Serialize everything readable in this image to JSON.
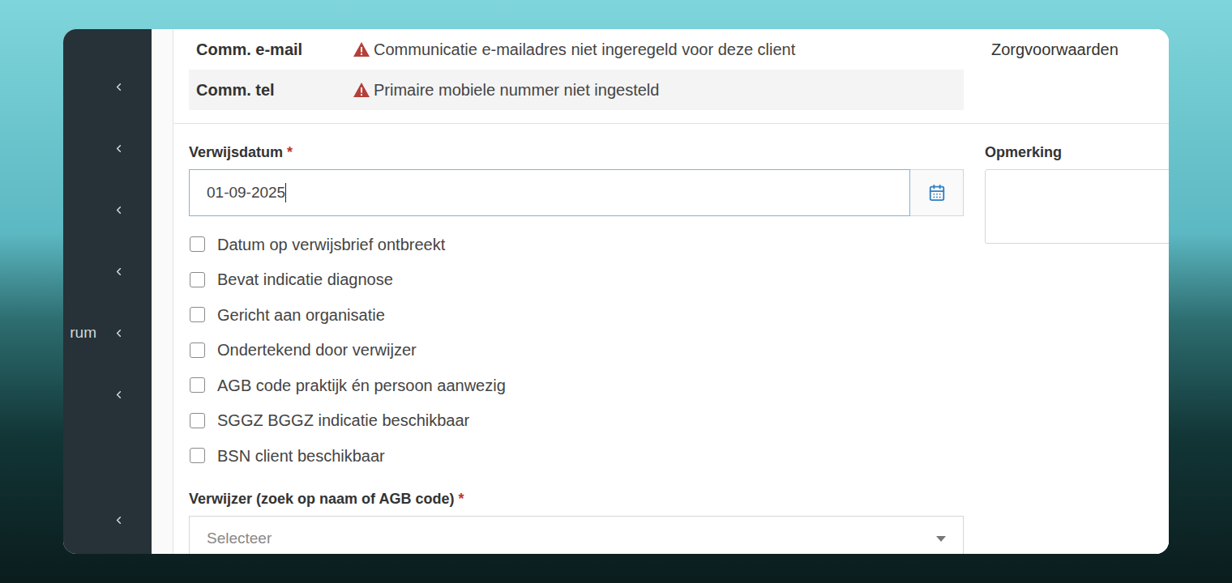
{
  "sidebar": {
    "items": [
      {
        "expanded": false
      },
      {
        "expanded": false
      },
      {
        "expanded": false
      },
      {
        "expanded": false
      },
      {
        "label": "rum",
        "expanded": false
      },
      {
        "expanded": false
      },
      {
        "expanded": false
      }
    ]
  },
  "contact": {
    "rows": [
      {
        "label": "Comm. e-mail",
        "warning": "Communicatie e-mailadres niet ingeregeld voor deze client",
        "shaded": false
      },
      {
        "label": "Comm. tel",
        "warning": "Primaire mobiele nummer niet ingesteld",
        "shaded": true
      }
    ],
    "side_label": "Zorgvoorwaarden"
  },
  "form": {
    "referral_date": {
      "label": "Verwijsdatum",
      "required_mark": "*",
      "value": "01-09-2025",
      "focused": true
    },
    "checks": [
      {
        "label": "Datum op verwijsbrief ontbreekt",
        "checked": false
      },
      {
        "label": "Bevat indicatie diagnose",
        "checked": false
      },
      {
        "label": "Gericht aan organisatie",
        "checked": false
      },
      {
        "label": "Ondertekend door verwijzer",
        "checked": false
      },
      {
        "label": "AGB code praktijk én persoon aanwezig",
        "checked": false
      },
      {
        "label": "SGGZ BGGZ indicatie beschikbaar",
        "checked": false
      },
      {
        "label": "BSN client beschikbaar",
        "checked": false
      }
    ],
    "remark": {
      "label": "Opmerking"
    },
    "referrer": {
      "label": "Verwijzer (zoek op naam of AGB code)",
      "required_mark": "*",
      "placeholder": "Selecteer"
    }
  }
}
